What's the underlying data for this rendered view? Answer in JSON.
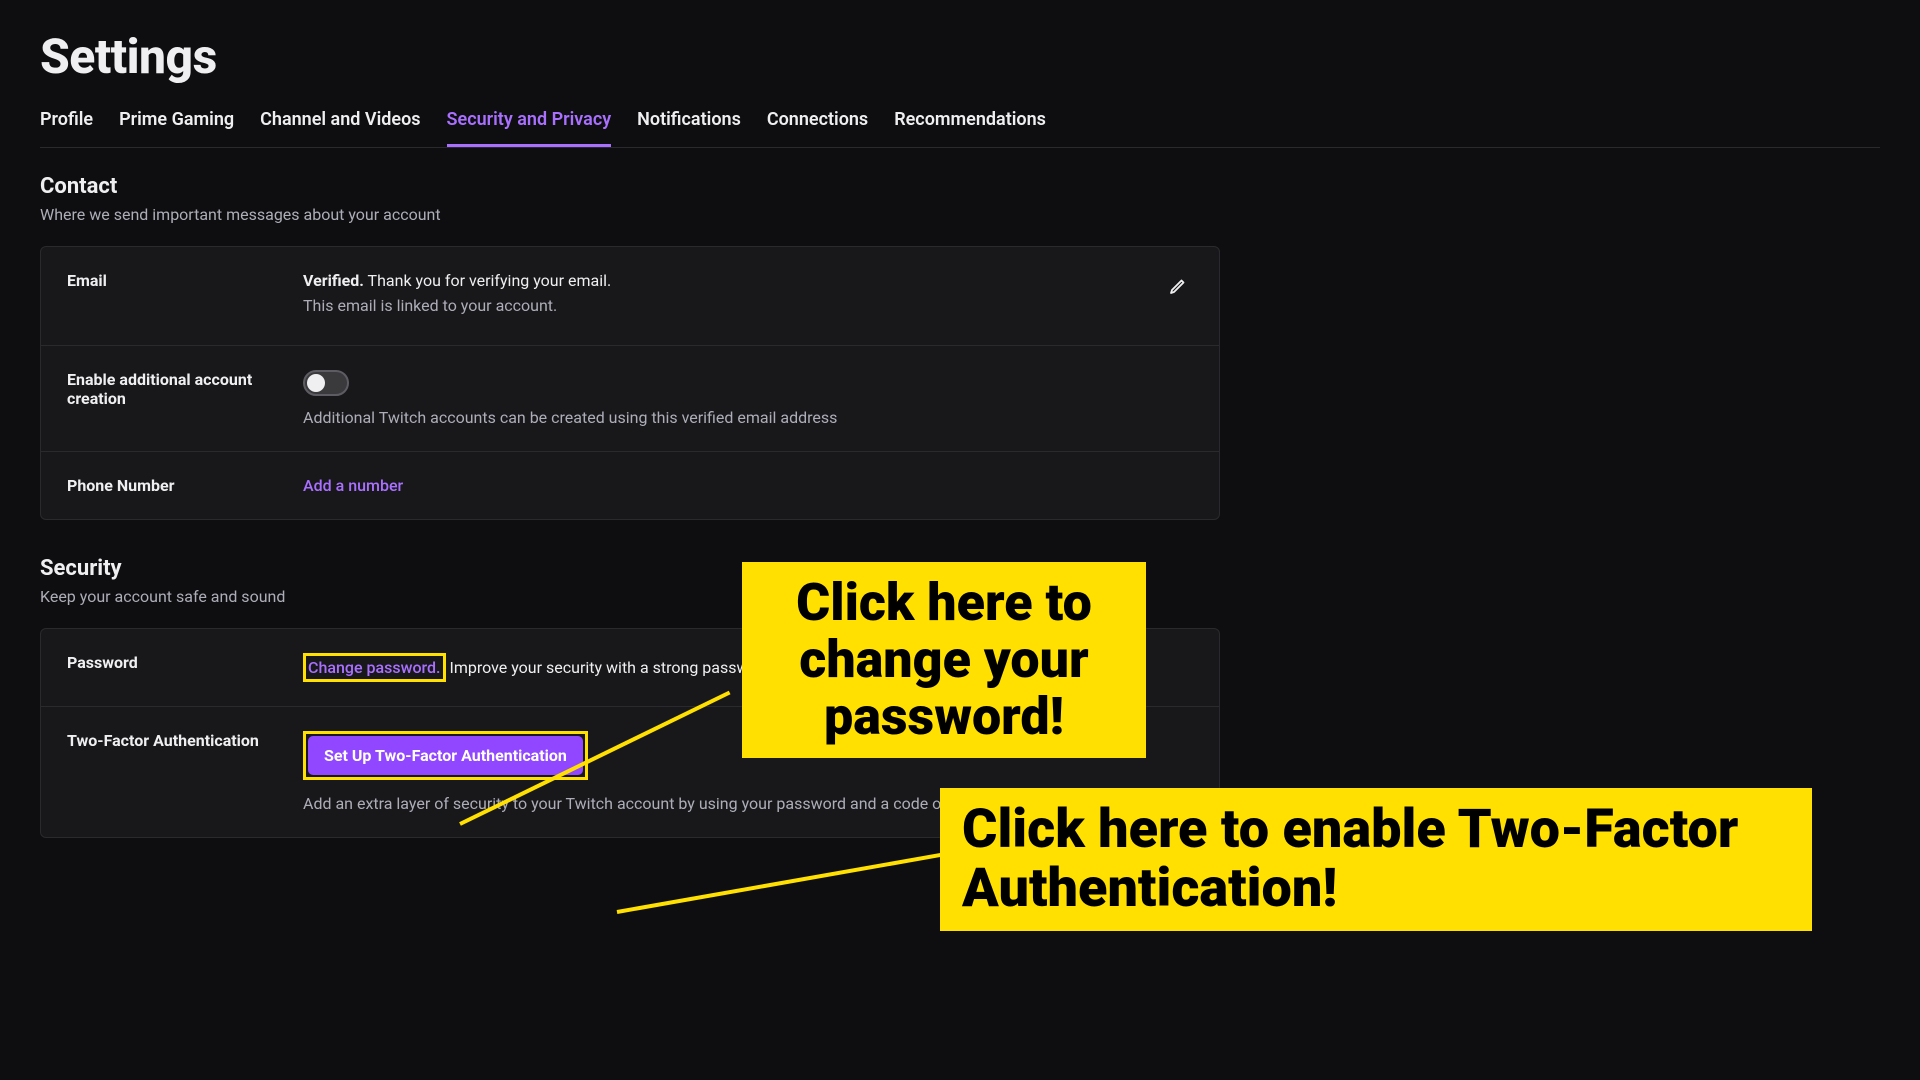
{
  "page": {
    "title": "Settings"
  },
  "tabs": [
    {
      "label": "Profile",
      "active": false
    },
    {
      "label": "Prime Gaming",
      "active": false
    },
    {
      "label": "Channel and Videos",
      "active": false
    },
    {
      "label": "Security and Privacy",
      "active": true
    },
    {
      "label": "Notifications",
      "active": false
    },
    {
      "label": "Connections",
      "active": false
    },
    {
      "label": "Recommendations",
      "active": false
    }
  ],
  "contact": {
    "heading": "Contact",
    "desc": "Where we send important messages about your account",
    "email": {
      "label": "Email",
      "verified_prefix": "Verified.",
      "verified_text": " Thank you for verifying your email.",
      "linked_text": "This email is linked to your account."
    },
    "additional": {
      "label": "Enable additional account creation",
      "desc": "Additional Twitch accounts can be created using this verified email address"
    },
    "phone": {
      "label": "Phone Number",
      "link": "Add a number"
    }
  },
  "security": {
    "heading": "Security",
    "desc": "Keep your account safe and sound",
    "password": {
      "label": "Password",
      "link": "Change password.",
      "after": " Improve your security with a strong password."
    },
    "twofactor": {
      "label": "Two-Factor Authentication",
      "button": "Set Up Two-Factor Authentication",
      "desc": "Add an extra layer of security to your Twitch account by using your password and a code on your mobile phone to log in."
    }
  },
  "annotations": {
    "a1": "Click here to change your password!",
    "a2": "Click here to enable Two-Factor Authentication!"
  }
}
